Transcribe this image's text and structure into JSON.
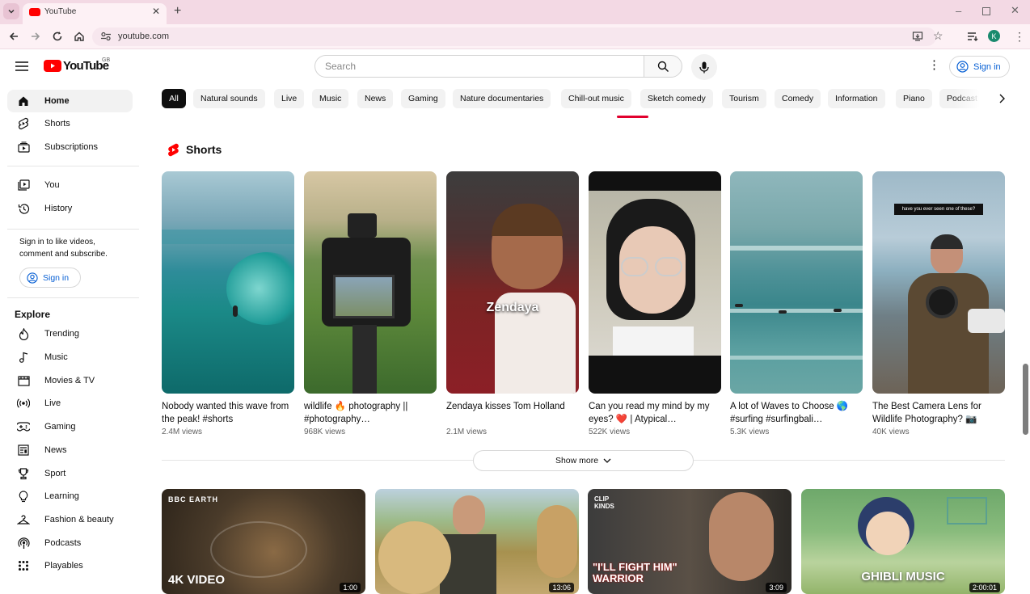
{
  "browser": {
    "tab_title": "YouTube",
    "url": "youtube.com",
    "profile_initial": "K"
  },
  "header": {
    "logo_text": "YouTube",
    "country_code": "GB",
    "search_placeholder": "Search",
    "sign_in": "Sign in"
  },
  "sidebar": {
    "top": [
      {
        "label": "Home",
        "icon": "home-icon"
      },
      {
        "label": "Shorts",
        "icon": "shorts-icon"
      },
      {
        "label": "Subscriptions",
        "icon": "subscriptions-icon"
      }
    ],
    "you": [
      {
        "label": "You",
        "icon": "you-icon"
      },
      {
        "label": "History",
        "icon": "history-icon"
      }
    ],
    "signin_prompt": "Sign in to like videos, comment and subscribe.",
    "signin_button": "Sign in",
    "explore_title": "Explore",
    "explore": [
      {
        "label": "Trending",
        "icon": "trending-icon"
      },
      {
        "label": "Music",
        "icon": "music-icon"
      },
      {
        "label": "Movies & TV",
        "icon": "movies-icon"
      },
      {
        "label": "Live",
        "icon": "live-icon"
      },
      {
        "label": "Gaming",
        "icon": "gaming-icon"
      },
      {
        "label": "News",
        "icon": "news-icon"
      },
      {
        "label": "Sport",
        "icon": "sport-icon"
      },
      {
        "label": "Learning",
        "icon": "learning-icon"
      },
      {
        "label": "Fashion & beauty",
        "icon": "fashion-icon"
      },
      {
        "label": "Podcasts",
        "icon": "podcasts-icon"
      },
      {
        "label": "Playables",
        "icon": "playables-icon"
      }
    ]
  },
  "chips": [
    "All",
    "Natural sounds",
    "Live",
    "Music",
    "News",
    "Gaming",
    "Nature documentaries",
    "Chill-out music",
    "Sketch comedy",
    "Tourism",
    "Comedy",
    "Information",
    "Piano",
    "Podcast"
  ],
  "shorts": {
    "title": "Shorts",
    "items": [
      {
        "title": "Nobody wanted this wave from the peak! #shorts",
        "views": "2.4M views"
      },
      {
        "title": "wildlife 🔥 photography || #photography…",
        "views": "968K views"
      },
      {
        "title": "Zendaya kisses Tom Holland",
        "views": "2.1M views",
        "overlay": "Zendaya"
      },
      {
        "title": "Can you read my mind by my eyes? ❤️ | Atypical…",
        "views": "522K views"
      },
      {
        "title": "A lot of Waves to Choose 🌎 #surfing #surfingbali…",
        "views": "5.3K views"
      },
      {
        "title": "The Best Camera Lens for Wildlife Photography? 📷",
        "views": "40K views",
        "overlay": "have you ever seen one of these?"
      }
    ],
    "show_more": "Show more"
  },
  "videos": [
    {
      "badge": "BBC EARTH",
      "overlay": "4K VIDEO",
      "duration": "1:00"
    },
    {
      "badge": "",
      "overlay": "",
      "duration": "13:06"
    },
    {
      "badge": "CLIP KINDS",
      "overlay": "\"I'LL FIGHT HIM\" WARRIOR",
      "duration": "3:09"
    },
    {
      "badge": "",
      "overlay": "GHIBLI MUSIC",
      "duration": "2:00:01"
    }
  ],
  "colors": {
    "accent": "#ff0000",
    "link": "#065fd4",
    "chip_active": "#0f0f0f"
  }
}
